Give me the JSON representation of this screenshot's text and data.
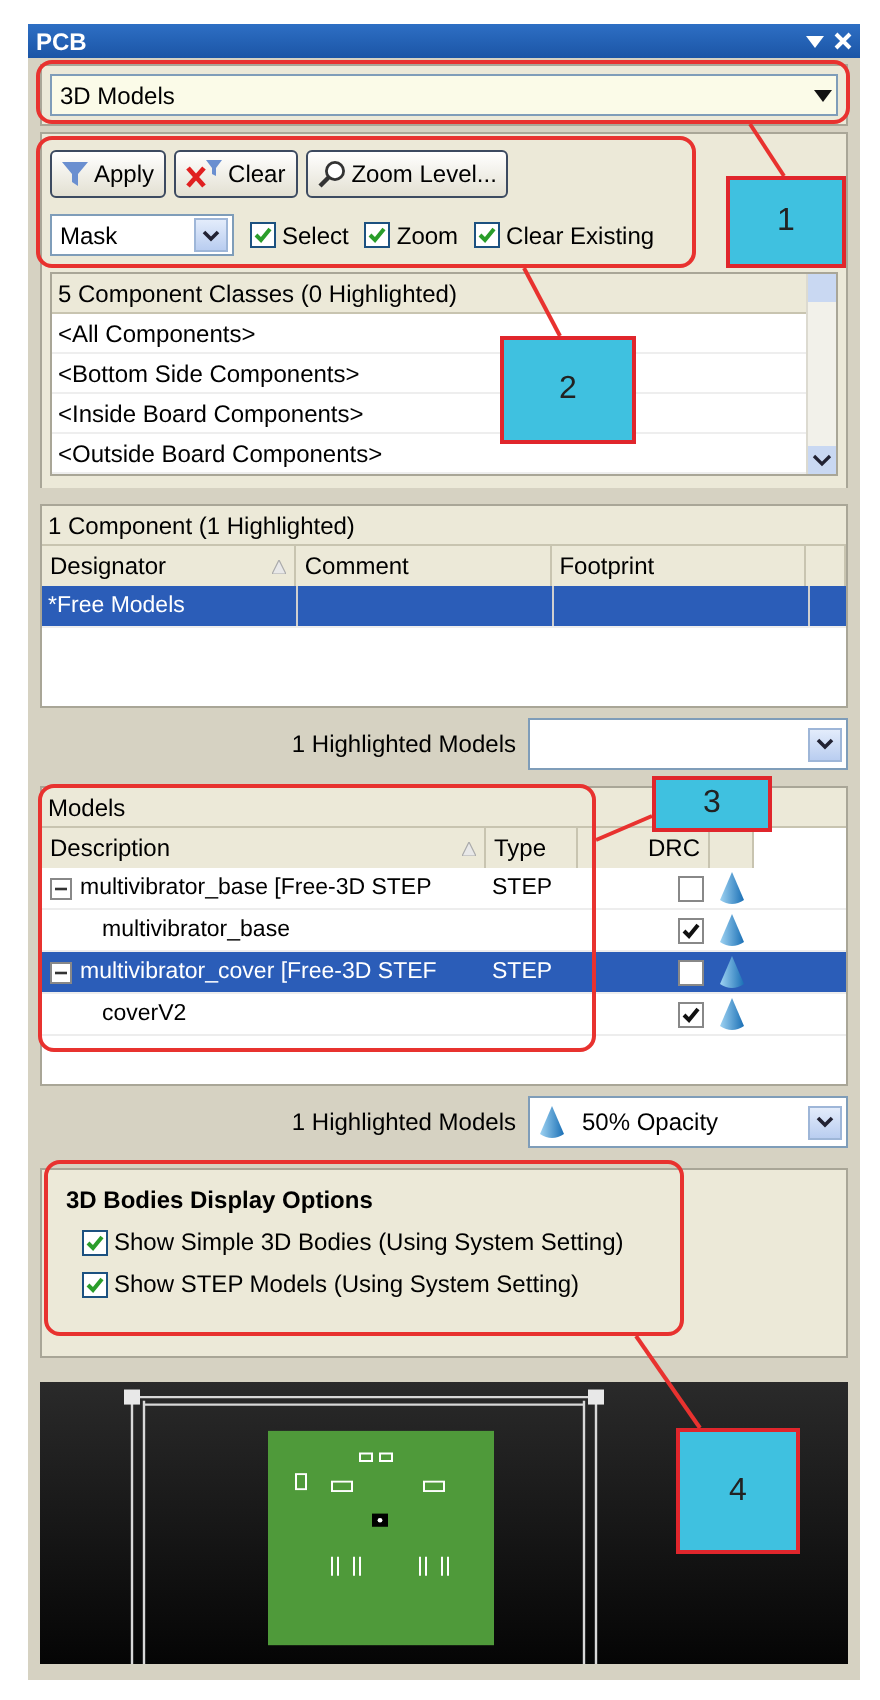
{
  "panel": {
    "title": "PCB"
  },
  "mode_dropdown": {
    "value": "3D Models"
  },
  "buttons": [
    {
      "label": "Apply"
    },
    {
      "label": "Clear"
    },
    {
      "label": "Zoom Level..."
    }
  ],
  "mask_dropdown": {
    "value": "Mask"
  },
  "options": [
    {
      "label": "Select",
      "checked": true
    },
    {
      "label": "Zoom",
      "checked": true
    },
    {
      "label": "Clear Existing",
      "checked": true
    }
  ],
  "classes": {
    "header": "5 Component Classes (0 Highlighted)",
    "items": [
      "<All Components>",
      "<Bottom Side Components>",
      "<Inside Board Components>",
      "<Outside Board Components>"
    ]
  },
  "components": {
    "header": "1 Component (1 Highlighted)",
    "columns": [
      "Designator",
      "Comment",
      "Footprint"
    ],
    "rows": [
      {
        "designator": "*Free Models",
        "selected": true
      }
    ]
  },
  "highlighted_models_1": {
    "label": "1 Highlighted Models"
  },
  "models": {
    "header": "Models",
    "columns": [
      "Description",
      "Type",
      "DRC"
    ],
    "rows": [
      {
        "description": "multivibrator_base [Free-3D STEP",
        "type": "STEP",
        "drc": false,
        "selected": false,
        "expanded": true,
        "children": [
          {
            "description": "multivibrator_base",
            "drc": true,
            "selected": false
          }
        ]
      },
      {
        "description": "multivibrator_cover [Free-3D STEF",
        "type": "STEP",
        "drc": false,
        "selected": true,
        "expanded": true,
        "children": [
          {
            "description": "coverV2",
            "drc": true,
            "selected": false
          }
        ]
      }
    ]
  },
  "highlighted_models_2": {
    "label": "1 Highlighted Models",
    "value": "50% Opacity"
  },
  "display_options": {
    "title": "3D Bodies Display Options",
    "items": [
      {
        "label": "Show Simple 3D Bodies (Using System Setting)",
        "checked": true
      },
      {
        "label": "Show STEP Models (Using System Setting)",
        "checked": true
      }
    ]
  },
  "callouts": [
    {
      "label": "1"
    },
    {
      "label": "2"
    },
    {
      "label": "3"
    },
    {
      "label": "4"
    }
  ]
}
